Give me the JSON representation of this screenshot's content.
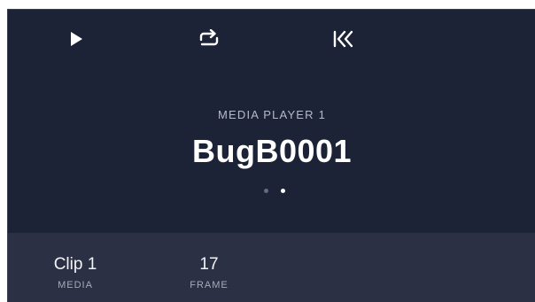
{
  "controls": {
    "play_icon": "play-icon",
    "loop_icon": "loop-icon",
    "rewind_icon": "skip-to-start-icon"
  },
  "player": {
    "label": "MEDIA PLAYER 1",
    "clip_name": "BugB0001",
    "page_count": 2,
    "active_page": 2
  },
  "info": {
    "media_value": "Clip 1",
    "media_label": "MEDIA",
    "frame_value": "17",
    "frame_label": "FRAME"
  },
  "colors": {
    "background": "#1d2336",
    "info_bar": "#2b3044",
    "text": "#ffffff",
    "muted_text": "#b6bac6"
  }
}
